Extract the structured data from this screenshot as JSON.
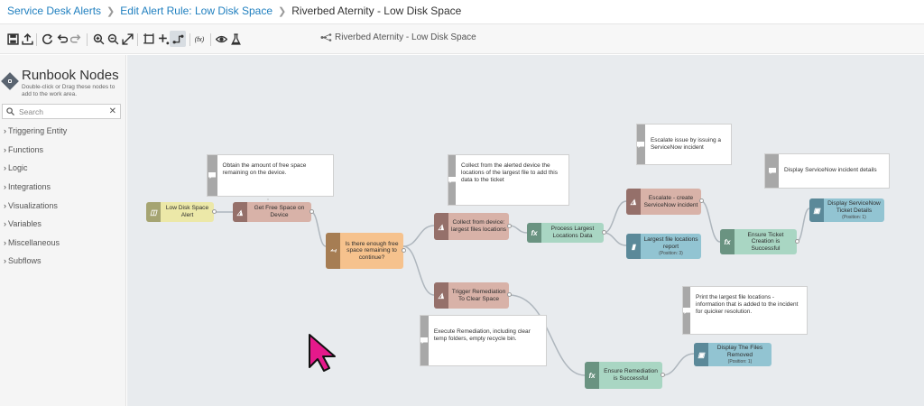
{
  "breadcrumb": {
    "items": [
      "Service Desk Alerts",
      "Edit Alert Rule: Low Disk Space"
    ],
    "current": "Riverbed Aternity - Low Disk Space"
  },
  "toolbar": {
    "canvas_title": "Riverbed Aternity - Low Disk Space",
    "fx_label": "(fx)"
  },
  "sidebar": {
    "title": "Runbook Nodes",
    "subtitle": "Double-click or Drag these nodes to add to the work area.",
    "search_placeholder": "Search",
    "items": [
      "Triggering Entity",
      "Functions",
      "Logic",
      "Integrations",
      "Visualizations",
      "Variables",
      "Miscellaneous",
      "Subflows"
    ]
  },
  "nodes": [
    {
      "id": "low-disk-space-alert",
      "label": "Low Disk Space Alert",
      "kind": "trigger",
      "icon": "trigger-icon"
    },
    {
      "id": "get-free-space",
      "label": "Get Free Space on Device",
      "kind": "op",
      "icon": "globe-icon"
    },
    {
      "id": "free-space-check",
      "label": "Is there enough free space remaining to continue?",
      "kind": "logic",
      "icon": "branch-icon"
    },
    {
      "id": "collect-largest-files",
      "label": "Collect from device: largest files locations",
      "kind": "op",
      "icon": "globe-icon"
    },
    {
      "id": "process-largest-locations",
      "label": "Process Largest Locations Data",
      "kind": "fn",
      "icon": "fx-icon"
    },
    {
      "id": "escalate-servicenow",
      "label": "Escalate - create ServiceNow incident",
      "kind": "op",
      "icon": "globe-icon"
    },
    {
      "id": "largest-locations-report",
      "label": "Largest file locations report",
      "sub": "(Position: 3)",
      "kind": "viz",
      "icon": "bar-chart-icon"
    },
    {
      "id": "ensure-ticket-creation",
      "label": "Ensure Ticket Creation is Successful",
      "kind": "fn",
      "icon": "fx-icon"
    },
    {
      "id": "display-ticket-details",
      "label": "Display ServiceNow Ticket Details",
      "sub": "(Position: 1)",
      "kind": "viz",
      "icon": "comment-icon"
    },
    {
      "id": "trigger-remediation",
      "label": "Trigger Remediation To Clear Space",
      "kind": "op",
      "icon": "globe-icon"
    },
    {
      "id": "ensure-remediation",
      "label": "Ensure Remediation is Successful",
      "kind": "fn",
      "icon": "fx-icon"
    },
    {
      "id": "display-files-removed",
      "label": "Display The Files Removed",
      "sub": "(Position: 1)",
      "kind": "viz",
      "icon": "comment-icon"
    }
  ],
  "notes": [
    {
      "id": "note-free-space",
      "text": "Obtain the amount of free space remaining on the device."
    },
    {
      "id": "note-collect",
      "text": "Collect from the alerted device the locations of the largest file to add this data to the ticket"
    },
    {
      "id": "note-escalate",
      "text": "Escalate issue by issuing a ServiceNow incident"
    },
    {
      "id": "note-display",
      "text": "Display ServiceNow incident details"
    },
    {
      "id": "note-print",
      "text": "Print the largest file locations - information that is added to the incident for quicker resolution."
    },
    {
      "id": "note-remediation",
      "text": "Execute Remediation, including clear temp folders, empty recycle bin."
    }
  ],
  "colors": {
    "link": "#1f7fbf",
    "canvas_bg": "#e8ebee",
    "cursor": "#e5198b"
  }
}
